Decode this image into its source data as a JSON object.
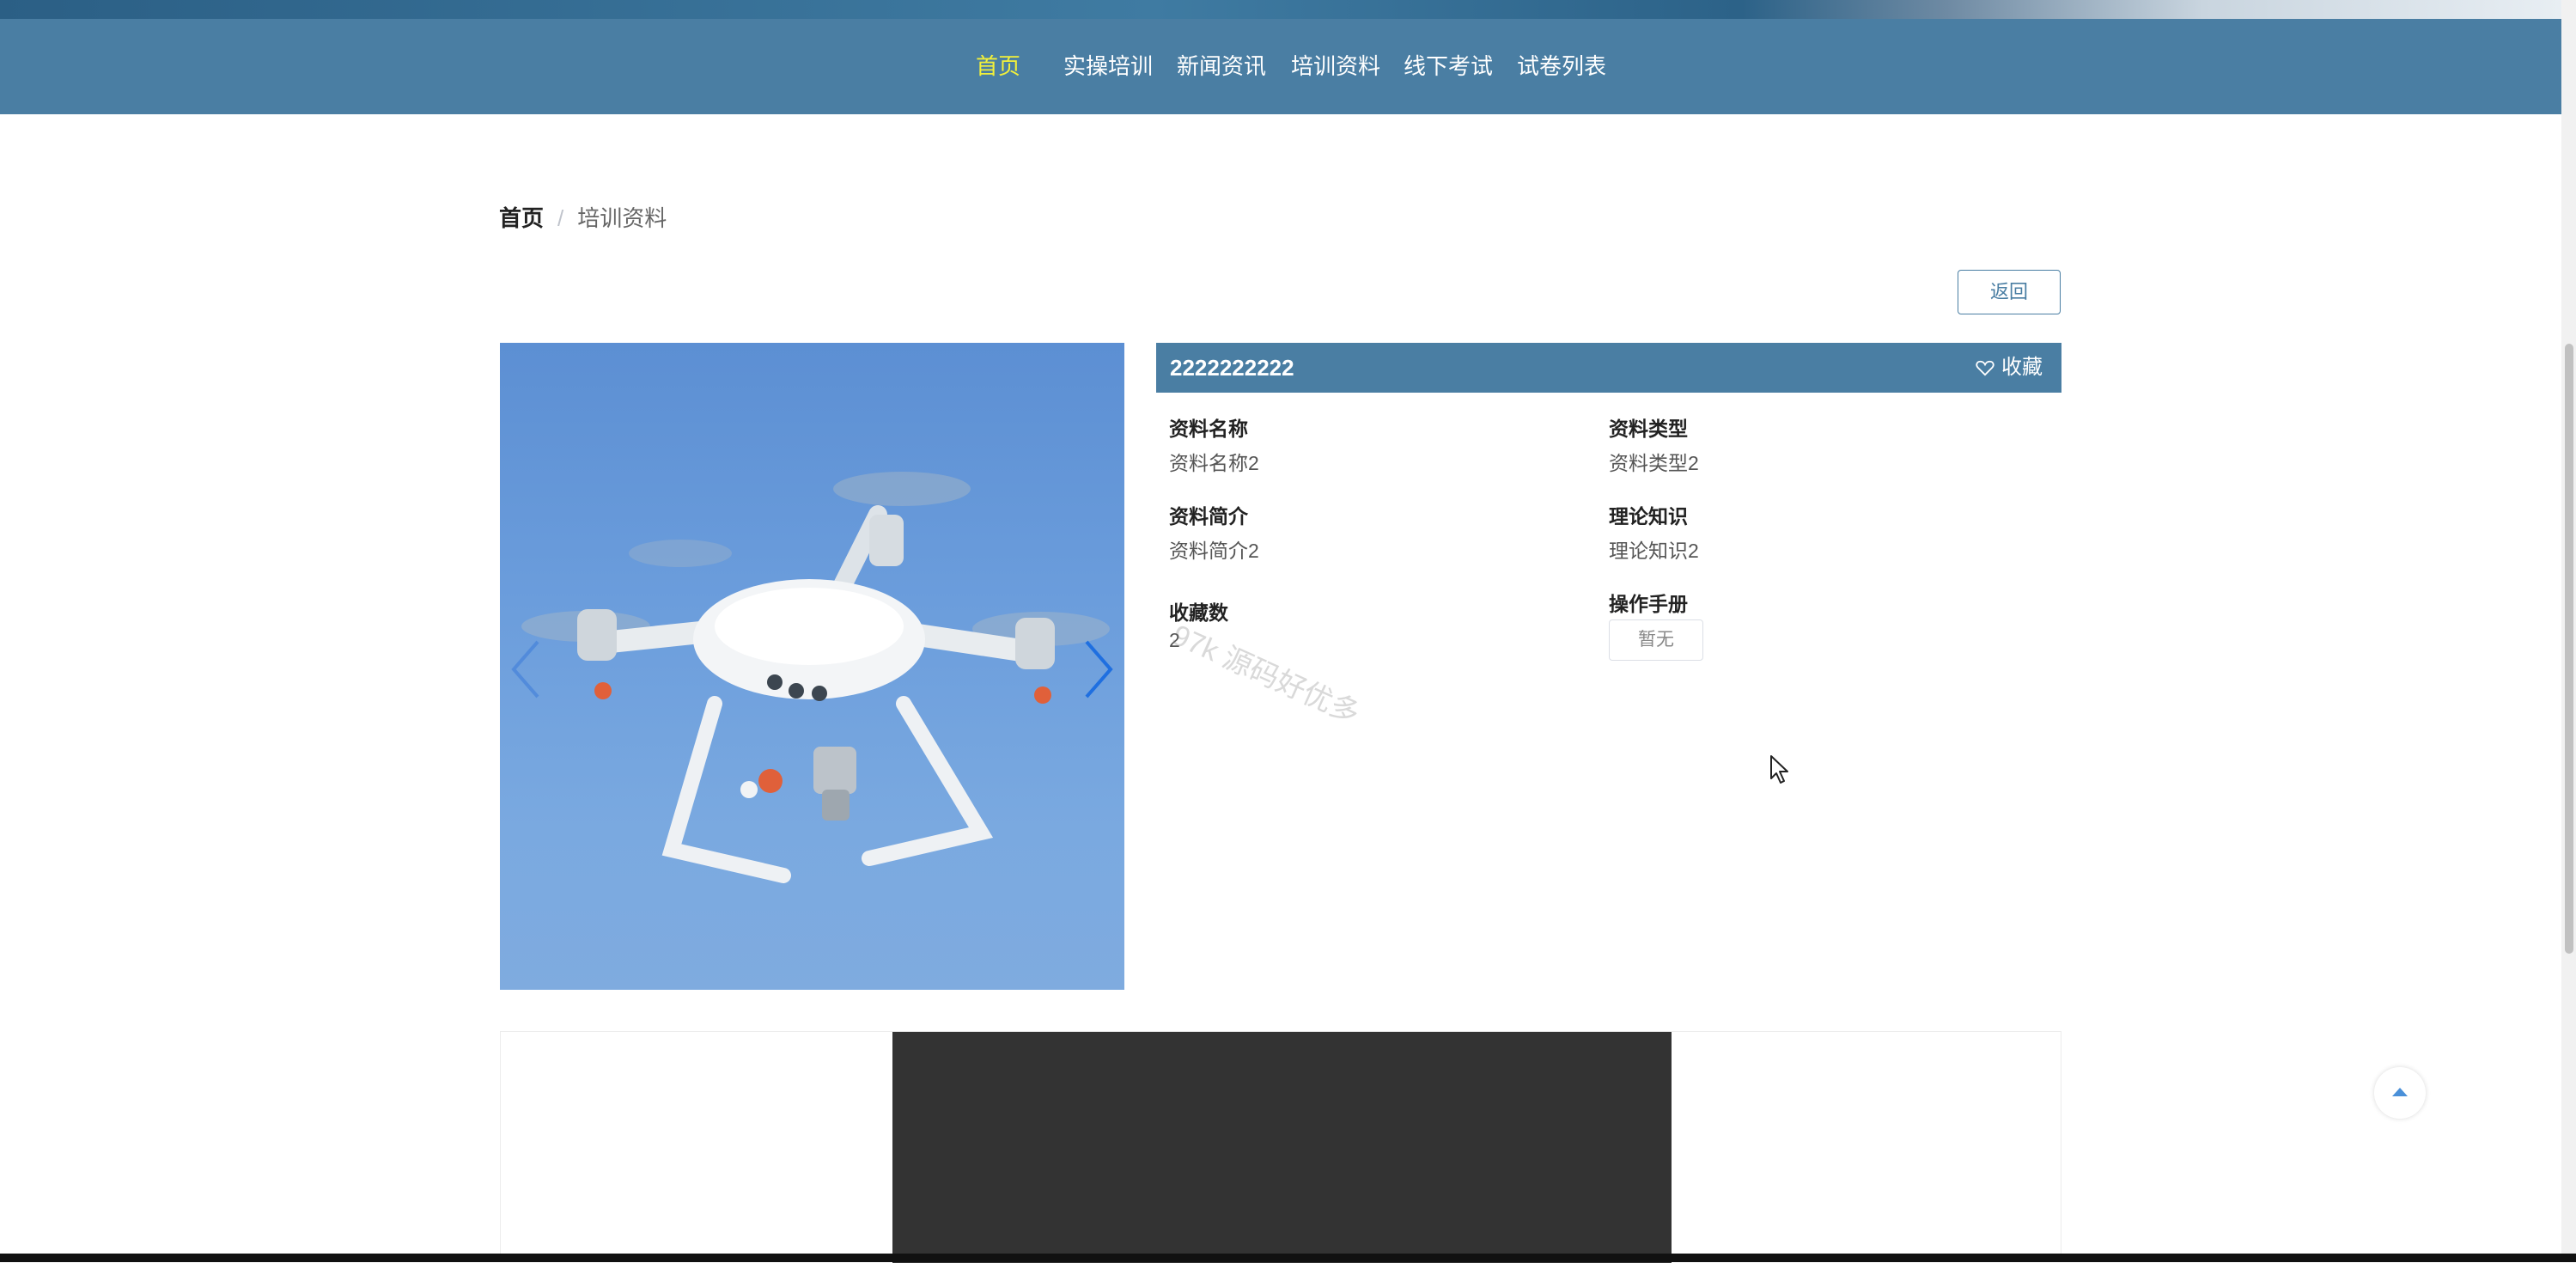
{
  "nav": {
    "items": [
      {
        "label": "首页",
        "active": true
      },
      {
        "label": "实操培训",
        "active": false
      },
      {
        "label": "新闻资讯",
        "active": false
      },
      {
        "label": "培训资料",
        "active": false
      },
      {
        "label": "线下考试",
        "active": false
      },
      {
        "label": "试卷列表",
        "active": false
      }
    ]
  },
  "breadcrumb": {
    "home": "首页",
    "separator": "/",
    "current": "培训资料"
  },
  "actions": {
    "back_label": "返回"
  },
  "detail": {
    "title": "2222222222",
    "favorite_label": "收藏",
    "fields": {
      "name_label": "资料名称",
      "name_value": "资料名称2",
      "type_label": "资料类型",
      "type_value": "资料类型2",
      "intro_label": "资料简介",
      "intro_value": "资料简介2",
      "theory_label": "理论知识",
      "theory_value": "理论知识2",
      "fav_count_label": "收藏数",
      "fav_count_value": "2",
      "manual_label": "操作手册",
      "manual_value": "暂无"
    }
  },
  "watermark": "97k 源码好优多",
  "colors": {
    "nav_bg": "#4a7ea3",
    "nav_active": "#f2f03a",
    "accent": "#4a7ea3",
    "video_bg": "#333333"
  },
  "icons": {
    "favorite": "heart-outline-icon",
    "carousel_prev": "chevron-left-icon",
    "carousel_next": "chevron-right-icon",
    "back_to_top": "caret-up-icon",
    "cursor": "mouse-pointer-icon"
  }
}
